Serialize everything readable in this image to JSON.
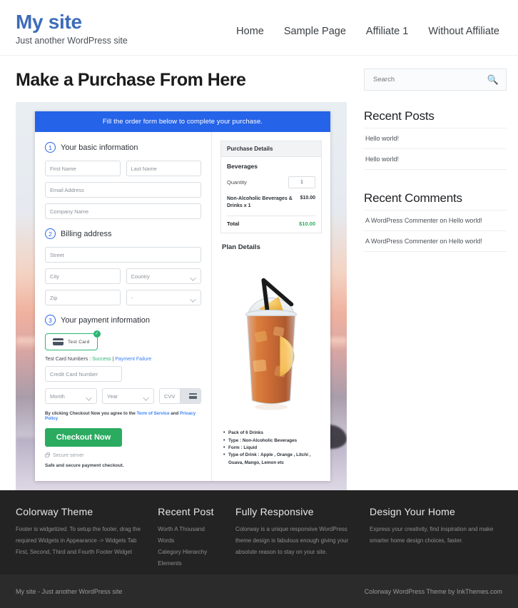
{
  "header": {
    "brand_title": "My site",
    "brand_tagline": "Just another WordPress site",
    "nav": [
      {
        "label": "Home"
      },
      {
        "label": "Sample Page"
      },
      {
        "label": "Affiliate 1"
      },
      {
        "label": "Without Affiliate"
      }
    ]
  },
  "main": {
    "page_title": "Make a Purchase From Here",
    "form": {
      "banner": "Fill the order form below to complete your purchase.",
      "steps": [
        {
          "num": "1",
          "label": "Your basic information"
        },
        {
          "num": "2",
          "label": "Billing address"
        },
        {
          "num": "3",
          "label": "Your payment information"
        }
      ],
      "fields": {
        "first_name": "First Name",
        "last_name": "Last Name",
        "email": "Email Address",
        "company": "Company Name",
        "street": "Street",
        "city": "City",
        "country": "Country",
        "zip": "Zip",
        "state": "-",
        "credit_card": "Credit Card Number",
        "month": "Month",
        "year": "Year",
        "cvv": "CVV"
      },
      "payment_method": "Test Card",
      "test_cards_prefix": "Test Card Numbers : ",
      "test_card_success": "Success",
      "test_card_separator": " | ",
      "test_card_failure": "Payment Failure",
      "terms_prefix": "By clicking Checkout Now you agree to the ",
      "terms_tos": "Term of Service",
      "terms_and": " and ",
      "terms_privacy": "Privacy Policy",
      "checkout_button": "Checkout Now",
      "secure_server": "Secure server",
      "safe_note": "Safe and secure payment checkout."
    },
    "purchase_details": {
      "heading": "Purchase Details",
      "group": "Beverages",
      "quantity_label": "Quantity",
      "quantity_value": "1",
      "item_name": "Non-Alcoholic Beverages & Drinks x 1",
      "item_price": "$10.00",
      "total_label": "Total",
      "total_value": "$10.00"
    },
    "plan": {
      "title": "Plan Details",
      "bullets": [
        "Pack of 6 Drinks",
        "Type : Non-Alcoholic Beverages",
        "Form : Liquid",
        "Type of Drink : Apple , Orange , Litchi , Guava, Mango, Lemon etc"
      ]
    }
  },
  "sidebar": {
    "search_placeholder": "Search",
    "search_icon": "search-icon",
    "widgets": [
      {
        "title": "Recent Posts",
        "items": [
          "Hello world!",
          "Hello world!"
        ]
      },
      {
        "title": "Recent Comments",
        "items": [
          "A WordPress Commenter on Hello world!",
          "A WordPress Commenter on Hello world!"
        ]
      }
    ]
  },
  "footer": {
    "columns": [
      {
        "title": "Colorway Theme",
        "text": "Footer is widgetized. To setup the footer, drag the required Widgets in Appearance -> Widgets Tab First, Second, Third and Fourth Footer Widget"
      },
      {
        "title": "Recent Post",
        "items": [
          "Worth A Thousand Words",
          "Category Hierarchy",
          "Elements"
        ]
      },
      {
        "title": "Fully Responsive",
        "text": "Colorway is a unique responsive WordPress theme design is fabulous enough giving your absolute reason to stay on your site."
      },
      {
        "title": "Design Your Home",
        "text": "Express your creativity, find inspiration and make smarter home design choices, faster."
      }
    ],
    "bottom_left": "My site - Just another WordPress site",
    "bottom_right": "Colorway WordPress Theme by InkThemes.com"
  },
  "colors": {
    "brand_blue": "#3d6cb9",
    "banner_blue": "#2563e9",
    "success_green": "#2bab60",
    "footer_dark": "#232323",
    "footer_bottom": "#2b2b2b"
  }
}
